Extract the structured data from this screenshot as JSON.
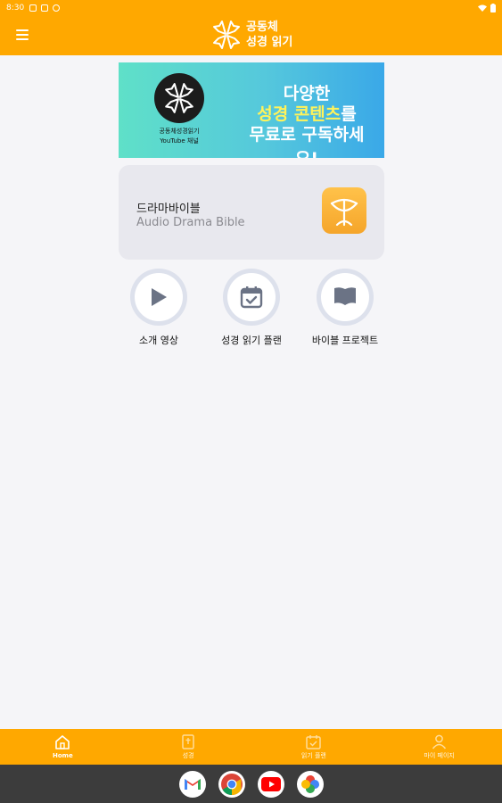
{
  "status_bar": {
    "time": "8:30"
  },
  "app_bar": {
    "title_line1": "공동체",
    "title_line2": "성경 읽기",
    "accent_color": "#ffa800"
  },
  "banner": {
    "logo_caption_line1": "공동체성경읽기",
    "logo_caption_line2": "YouTube 채널",
    "headline_line1": "다양한",
    "headline_highlight": "성경 콘텐츠",
    "headline_line2_suffix": "를",
    "headline_line3": "무료로 구독하세요!"
  },
  "drama_card": {
    "title": "드라마바이블",
    "subtitle": "Audio Drama Bible"
  },
  "quick_actions": [
    {
      "label": "소개 영상",
      "icon": "play-icon"
    },
    {
      "label": "성경 읽기 플랜",
      "icon": "calendar-check-icon"
    },
    {
      "label": "바이블 프로젝트",
      "icon": "book-icon"
    }
  ],
  "bottom_nav": [
    {
      "label": "Home",
      "icon": "home-icon",
      "active": true
    },
    {
      "label": "성경",
      "icon": "bible-icon",
      "active": false
    },
    {
      "label": "읽기 플랜",
      "icon": "plan-icon",
      "active": false
    },
    {
      "label": "마이 페이지",
      "icon": "person-icon",
      "active": false
    }
  ],
  "dock": [
    {
      "name": "Gmail",
      "icon": "gmail-icon"
    },
    {
      "name": "Chrome",
      "icon": "chrome-icon"
    },
    {
      "name": "YouTube",
      "icon": "youtube-icon"
    },
    {
      "name": "Photos",
      "icon": "photos-icon"
    }
  ]
}
